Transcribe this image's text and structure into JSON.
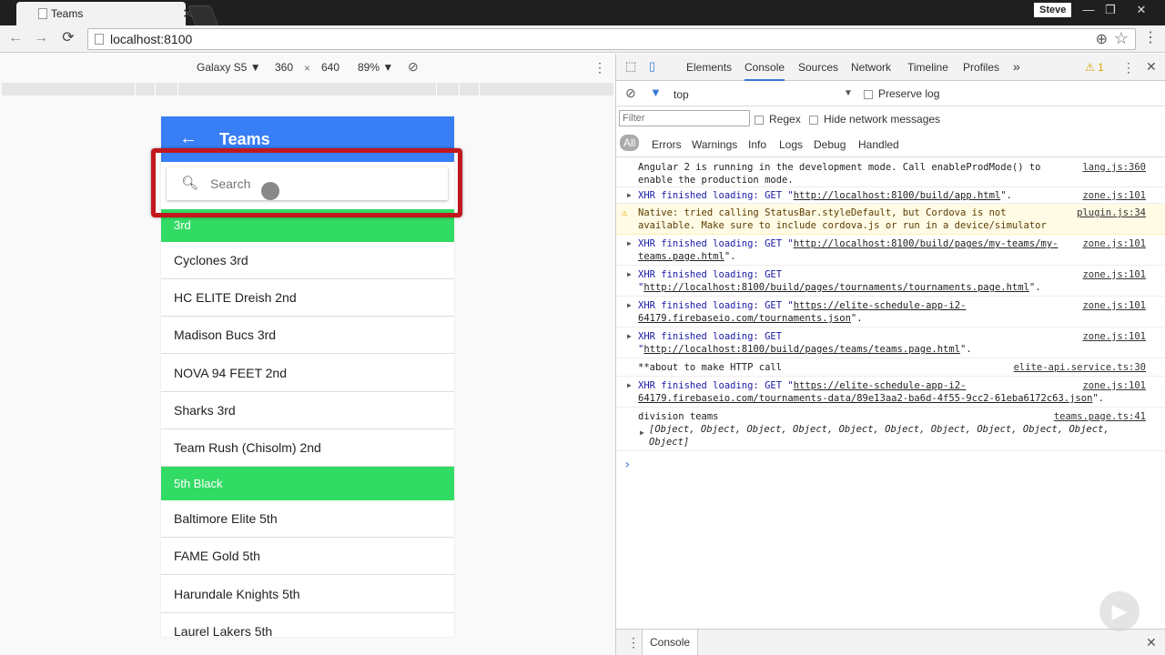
{
  "browser": {
    "tab_title": "Teams",
    "tab_close": "✕",
    "profile_name": "Steve",
    "url": "localhost:8100",
    "window_buttons": [
      "—",
      "❐",
      "✕"
    ]
  },
  "emulation": {
    "device": "Galaxy S5",
    "width": "360",
    "times": "×",
    "height": "640",
    "zoom": "89%"
  },
  "app": {
    "header_title": "Teams",
    "search_placeholder": "Search",
    "rows": [
      {
        "type": "divider",
        "label": "3rd"
      },
      {
        "type": "team",
        "label": "Cyclones 3rd"
      },
      {
        "type": "team",
        "label": "HC ELITE Dreish 2nd"
      },
      {
        "type": "team",
        "label": "Madison Bucs 3rd"
      },
      {
        "type": "team",
        "label": "NOVA 94 FEET 2nd"
      },
      {
        "type": "team",
        "label": "Sharks 3rd"
      },
      {
        "type": "team",
        "label": "Team Rush (Chisolm) 2nd"
      },
      {
        "type": "divider",
        "label": "5th Black"
      },
      {
        "type": "team",
        "label": "Baltimore Elite 5th"
      },
      {
        "type": "team",
        "label": "FAME Gold 5th"
      },
      {
        "type": "team",
        "label": "Harundale Knights 5th"
      },
      {
        "type": "team",
        "label": "Laurel Lakers 5th"
      }
    ]
  },
  "devtools": {
    "tabs": [
      "Elements",
      "Console",
      "Sources",
      "Network",
      "Timeline",
      "Profiles"
    ],
    "more_tabs": "»",
    "warning_count": "1",
    "context": "top",
    "preserve_log": "Preserve log",
    "filter_placeholder": "Filter",
    "regex": "Regex",
    "hide_network": "Hide network messages",
    "levels": [
      "All",
      "Errors",
      "Warnings",
      "Info",
      "Logs",
      "Debug",
      "Handled"
    ],
    "messages": [
      {
        "text": "Angular 2 is running in the development mode. Call enableProdMode() to enable the production mode.",
        "source": "lang.js:360"
      },
      {
        "prefix": "XHR finished loading: GET \"",
        "link": "http://localhost:8100/build/app.html",
        "suffix": "\".",
        "source": "zone.js:101"
      },
      {
        "text": "Native: tried calling StatusBar.styleDefault, but Cordova is not available. Make sure to include cordova.js or run in a device/simulator",
        "source": "plugin.js:34"
      },
      {
        "prefix": "XHR finished loading: GET \"",
        "link": "http://localhost:8100/build/pages/my-teams/my-teams.page.html",
        "suffix": "\".",
        "source": "zone.js:101"
      },
      {
        "prefix": "XHR finished loading: GET \"",
        "link": "http://localhost:8100/build/pages/tournaments/tournaments.page.html",
        "suffix": "\".",
        "source": "zone.js:101"
      },
      {
        "prefix": "XHR finished loading: GET \"",
        "link": "https://elite-schedule-app-i2-64179.firebaseio.com/tournaments.json",
        "suffix": "\".",
        "source": "zone.js:101"
      },
      {
        "prefix": "XHR finished loading: GET \"",
        "link": "http://localhost:8100/build/pages/teams/teams.page.html",
        "suffix": "\".",
        "source": "zone.js:101"
      },
      {
        "text": "**about to make HTTP call",
        "source": "elite-api.service.ts:30"
      },
      {
        "prefix": "XHR finished loading: GET \"",
        "link": "https://elite-schedule-app-i2-64179.firebaseio.com/tournaments-data/89e13aa2-ba6d-4f55-9cc2-61eba6172c63.json",
        "suffix": "\".",
        "source": "zone.js:101"
      },
      {
        "text": "division teams",
        "source": "teams.page.ts:41"
      },
      {
        "text": "[Object, Object, Object, Object, Object, Object, Object, Object, Object, Object, Object]"
      }
    ],
    "drawer_tab": "Console"
  }
}
